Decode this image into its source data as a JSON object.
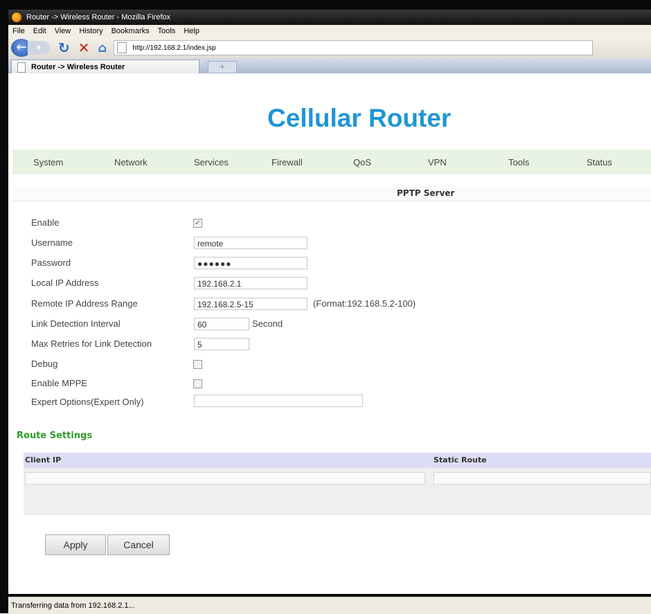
{
  "window": {
    "title": "Router -> Wireless Router - Mozilla Firefox"
  },
  "menubar": {
    "items": [
      "File",
      "Edit",
      "View",
      "History",
      "Bookmarks",
      "Tools",
      "Help"
    ]
  },
  "navbar": {
    "url": "http://192.168.2.1/index.jsp"
  },
  "tabs": {
    "active_label": "Router -> Wireless Router",
    "new_tab": "+"
  },
  "page": {
    "title": "Cellular Router",
    "menu": [
      "System",
      "Network",
      "Services",
      "Firewall",
      "QoS",
      "VPN",
      "Tools",
      "Status"
    ],
    "section_title": "PPTP Server",
    "form": {
      "enable_label": "Enable",
      "enable_checked": true,
      "username_label": "Username",
      "username_value": "remote",
      "password_label": "Password",
      "password_value": "●●●●●●",
      "local_ip_label": "Local IP Address",
      "local_ip_value": "192.168.2.1",
      "remote_ip_label": "Remote IP Address Range",
      "remote_ip_value": "192.168.2.5-15",
      "remote_ip_hint": "(Format:192.168.5.2-100)",
      "link_interval_label": "Link Detection Interval",
      "link_interval_value": "60",
      "link_interval_unit": "Second",
      "max_retries_label": "Max Retries for Link Detection",
      "max_retries_value": "5",
      "debug_label": "Debug",
      "debug_checked": false,
      "mppe_label": "Enable MPPE",
      "mppe_checked": false,
      "expert_label": "Expert Options(Expert Only)",
      "expert_value": ""
    },
    "route": {
      "title": "Route Settings",
      "col_client": "Client IP",
      "col_static": "Static Route"
    },
    "buttons": {
      "apply": "Apply",
      "cancel": "Cancel"
    }
  },
  "statusbar": {
    "text": "Transferring data from 192.168.2.1..."
  }
}
